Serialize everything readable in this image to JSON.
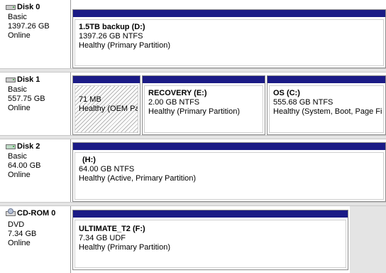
{
  "disks": [
    {
      "name": "Disk 0",
      "icon": "disk-icon",
      "type": "Basic",
      "size": "1397.26 GB",
      "status": "Online",
      "partitions": [
        {
          "label": "1.5TB backup  (D:)",
          "size": "1397.26 GB NTFS",
          "status": "Healthy (Primary Partition)"
        }
      ]
    },
    {
      "name": "Disk 1",
      "icon": "disk-icon",
      "type": "Basic",
      "size": "557.75 GB",
      "status": "Online",
      "partitions": [
        {
          "label": "",
          "size": "71 MB",
          "status": "Healthy (OEM Pa"
        },
        {
          "label": "RECOVERY  (E:)",
          "size": "2.00 GB NTFS",
          "status": "Healthy (Primary Partition)"
        },
        {
          "label": "OS  (C:)",
          "size": "555.68 GB NTFS",
          "status": "Healthy (System, Boot, Page Fi"
        }
      ]
    },
    {
      "name": "Disk 2",
      "icon": "disk-icon",
      "type": "Basic",
      "size": "64.00 GB",
      "status": "Online",
      "partitions": [
        {
          "label": "(H:)",
          "size": "64.00 GB NTFS",
          "status": "Healthy (Active, Primary Partition)"
        }
      ]
    },
    {
      "name": "CD-ROM 0",
      "icon": "cd-icon",
      "type": "DVD",
      "size": "7.34 GB",
      "status": "Online",
      "partitions": [
        {
          "label": "ULTIMATE_T2  (F:)",
          "size": "7.34 GB UDF",
          "status": "Healthy (Primary Partition)"
        }
      ]
    }
  ],
  "colors": {
    "partition_bar": "#1b1b86",
    "separator": "#e4e4e4"
  }
}
